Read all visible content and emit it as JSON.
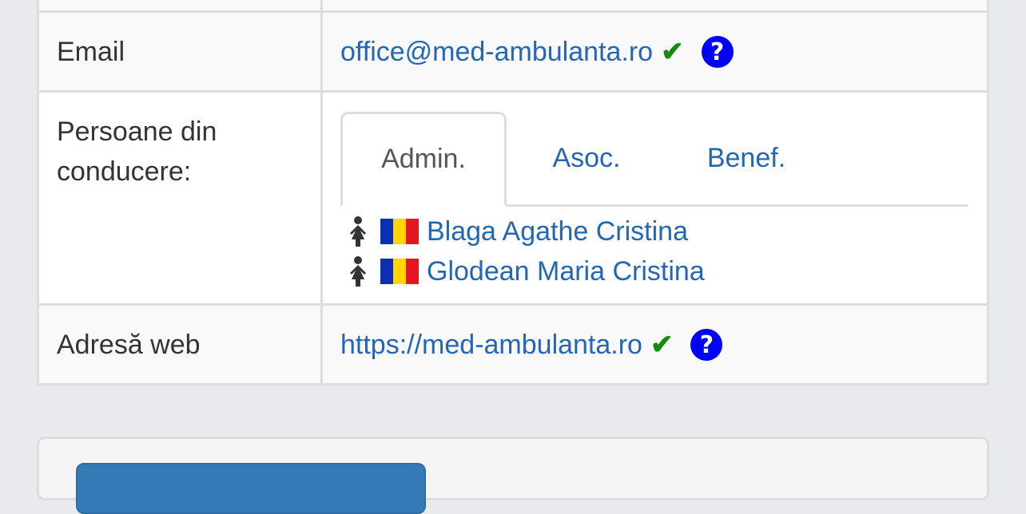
{
  "rows": {
    "email": {
      "label": "Email",
      "value": "office@med-ambulanta.ro",
      "check_icon": "check-icon",
      "help_icon": "question-circle-icon",
      "help_glyph": "?"
    },
    "leadership": {
      "label": "Persoane din conducere:",
      "tabs": [
        {
          "label": "Admin.",
          "active": true
        },
        {
          "label": "Asoc.",
          "active": false
        },
        {
          "label": "Benef.",
          "active": false
        }
      ],
      "persons": [
        {
          "name": "Blaga Agathe Cristina",
          "gender_icon": "female-icon",
          "flag": "romania-flag"
        },
        {
          "name": "Glodean Maria Cristina",
          "gender_icon": "female-icon",
          "flag": "romania-flag"
        }
      ]
    },
    "web": {
      "label": "Adresă web",
      "value": "https://med-ambulanta.ro",
      "check_icon": "check-icon",
      "help_icon": "question-circle-icon",
      "help_glyph": "?"
    }
  },
  "colors": {
    "link": "#2366b4",
    "check": "#148c14",
    "help": "#0000ff",
    "flag_blue": "#0a2fb4",
    "flag_yellow": "#ffd400",
    "flag_red": "#e4161e",
    "button": "#337ab7"
  }
}
